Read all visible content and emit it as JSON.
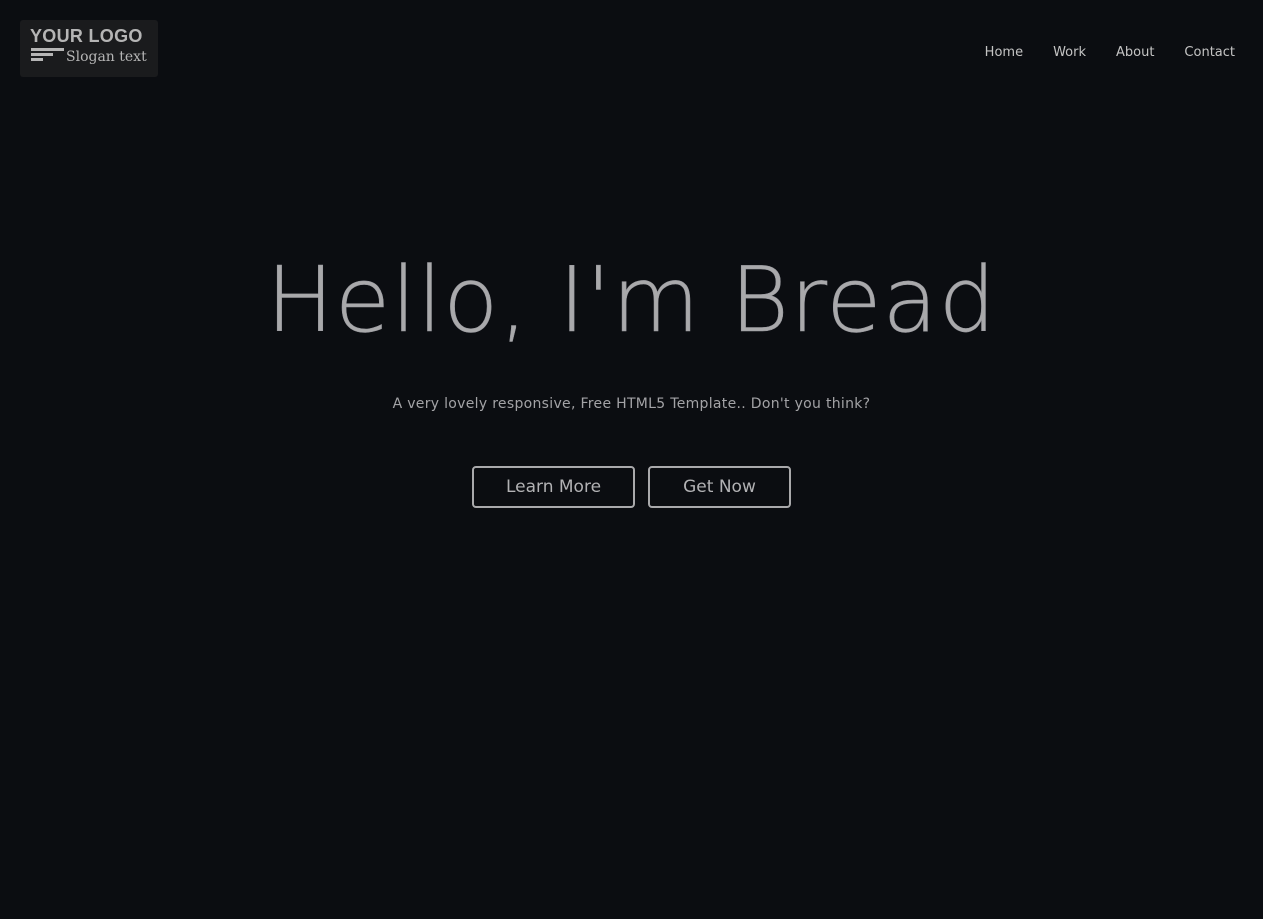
{
  "logo": {
    "main_text": "YOUR LOGO",
    "slogan": "Slogan text",
    "icon": "lines-icon"
  },
  "nav": {
    "items": [
      {
        "label": "Home"
      },
      {
        "label": "Work"
      },
      {
        "label": "About"
      },
      {
        "label": "Contact"
      }
    ]
  },
  "hero": {
    "title": "Hello, I'm Bread",
    "subtitle": "A very lovely responsive, Free HTML5 Template.. Don't you think?",
    "buttons": {
      "learn_more": "Learn More",
      "get_now": "Get Now"
    }
  },
  "colors": {
    "background": "#0b0d11",
    "text": "#a9a9ab",
    "logo_bg": "#1a1b1d"
  }
}
